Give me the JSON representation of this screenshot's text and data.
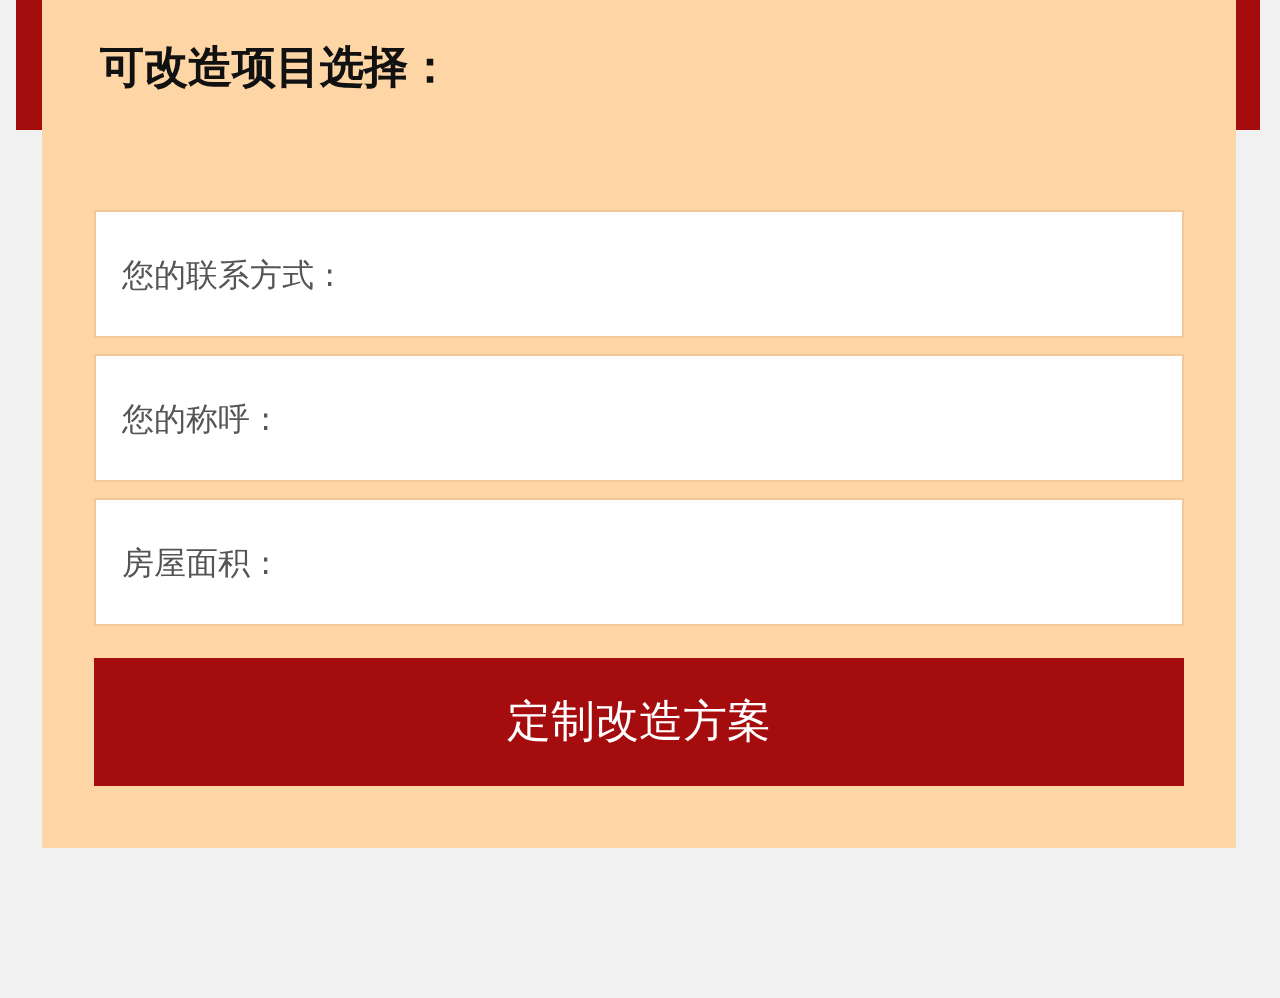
{
  "heading": "可改造项目选择：",
  "fields": [
    {
      "placeholder": "您的联系方式 :"
    },
    {
      "placeholder": "您的称呼 :"
    },
    {
      "placeholder": "房屋面积 :"
    }
  ],
  "submit_button": "定制改造方案"
}
